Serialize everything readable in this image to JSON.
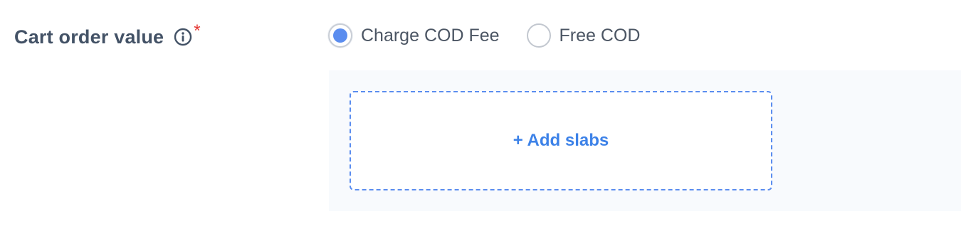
{
  "field": {
    "label": "Cart order value",
    "info_icon": "info-circle-icon",
    "required_mark": "*"
  },
  "radio_group": {
    "options": [
      {
        "label": "Charge COD Fee",
        "selected": true
      },
      {
        "label": "Free COD",
        "selected": false
      }
    ]
  },
  "slabs": {
    "add_label": "+ Add slabs"
  },
  "colors": {
    "label_text": "#435266",
    "required": "#e53935",
    "accent": "#5b8def",
    "add_link": "#3d82e8",
    "panel_bg": "#f8fafd"
  }
}
